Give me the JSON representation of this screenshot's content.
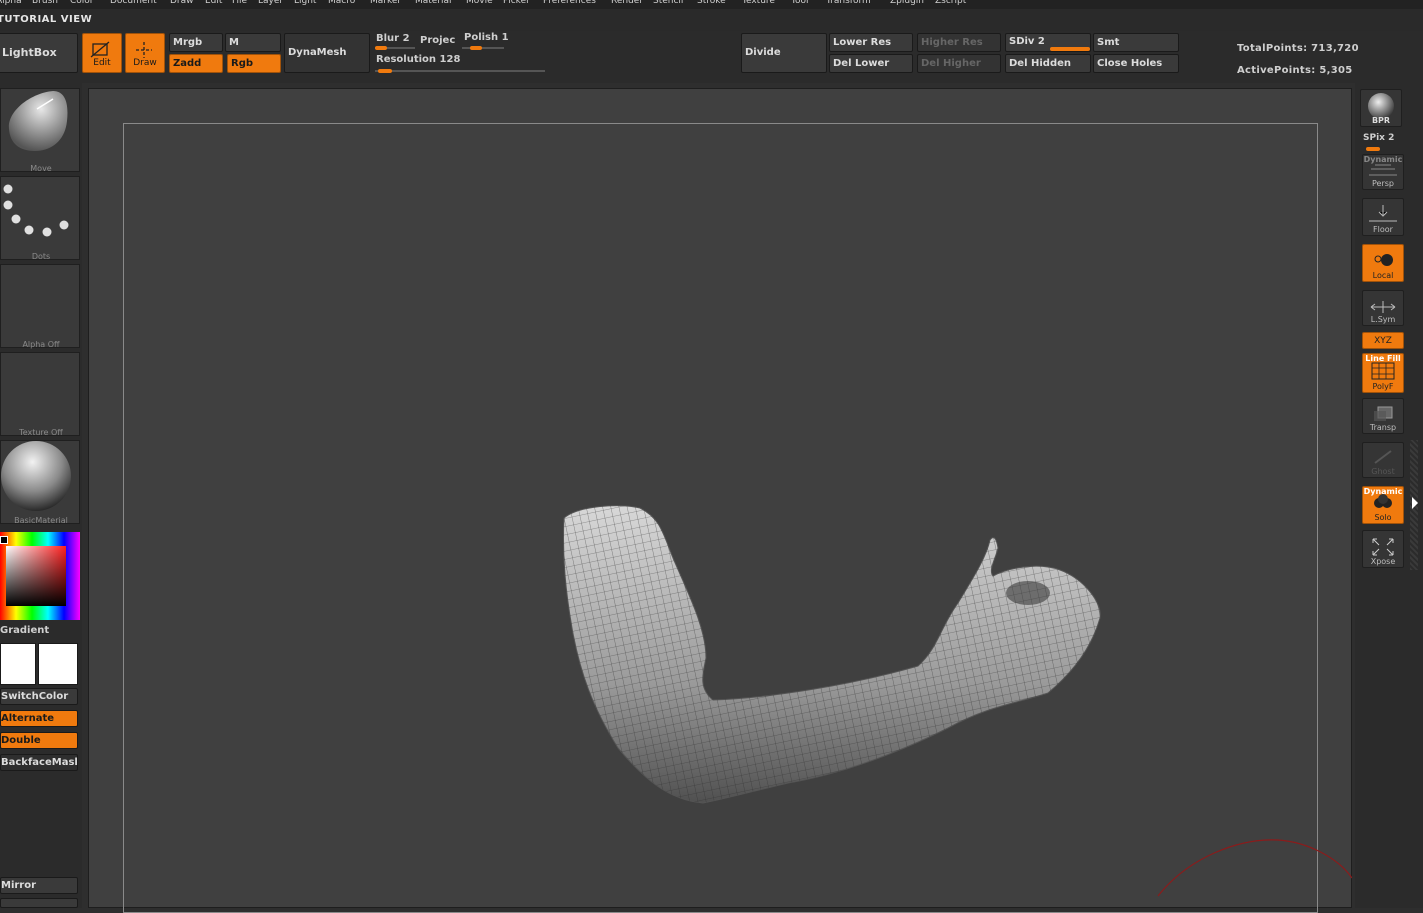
{
  "menu": [
    "Alpha",
    "Brush",
    "Color",
    "Document",
    "Draw",
    "Edit",
    "File",
    "Layer",
    "Light",
    "Macro",
    "Marker",
    "Material",
    "Movie",
    "Picker",
    "Preferences",
    "Render",
    "Stencil",
    "Stroke",
    "Texture",
    "Tool",
    "Transform",
    "Zplugin",
    "Zscript"
  ],
  "view_title": "TUTORIAL VIEW",
  "toolbar": {
    "lightbox": "LightBox",
    "edit": "Edit",
    "draw": "Draw",
    "mrgb": "Mrgb",
    "m": "M",
    "zadd": "Zadd",
    "rgb": "Rgb",
    "dynamesh": "DynaMesh",
    "blur": "Blur 2",
    "project": "Projec",
    "polish": "Polish 1",
    "resolution": "Resolution 128",
    "divide": "Divide",
    "lower_res": "Lower Res",
    "higher_res": "Higher Res",
    "sdiv": "SDiv 2",
    "smt": "Smt",
    "del_lower": "Del Lower",
    "del_higher": "Del Higher",
    "del_hidden": "Del Hidden",
    "close_holes": "Close Holes"
  },
  "stats": {
    "total_points": "TotalPoints: 713,720",
    "active_points": "ActivePoints: 5,305"
  },
  "left_panel": {
    "brush": "Move",
    "stroke": "Dots",
    "alpha": "Alpha  Off",
    "texture": "Texture  Off",
    "material": "BasicMaterial",
    "gradient": "Gradient",
    "switch_color": "SwitchColor",
    "alternate": "Alternate",
    "double": "Double",
    "backface_mask": "BackfaceMask",
    "mirror": "Mirror"
  },
  "right_panel": {
    "bpr": "BPR",
    "spix": "SPix 2",
    "dynamic": "Dynamic",
    "persp": "Persp",
    "floor": "Floor",
    "local": "Local",
    "lsym": "L.Sym",
    "xyz": "XYZ",
    "line_fill": "Line Fill",
    "polyf": "PolyF",
    "transp": "Transp",
    "ghost": "Ghost",
    "dynamic2": "Dynamic",
    "solo": "Solo",
    "xpose": "Xpose"
  },
  "colors": {
    "accent": "#f07a0e",
    "background": "#2b2b2b",
    "canvas": "#404040"
  }
}
